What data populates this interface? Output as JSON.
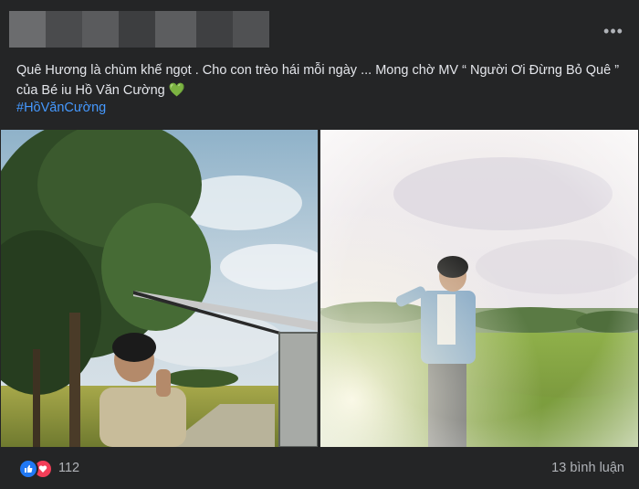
{
  "post": {
    "more_label": "•••",
    "text_line1": "Quê Hương là chùm khế ngọt . Cho con trèo hái mỗi ngày ... Mong chờ MV “ Người Ơi Đừng Bỏ Quê ”",
    "text_line2": "của Bé iu Hồ Văn Cường",
    "text_emoji": "💚",
    "hashtag": "#HồVănCường"
  },
  "footer": {
    "reaction_count": "112",
    "comment_count": "13 bình luận",
    "reaction_icons": [
      "like-icon",
      "love-icon"
    ]
  },
  "colors": {
    "background": "#242526",
    "text": "#e4e6eb",
    "secondary_text": "#b0b3b8",
    "link": "#4599ff",
    "like": "#2078f4",
    "love": "#f33e58"
  }
}
